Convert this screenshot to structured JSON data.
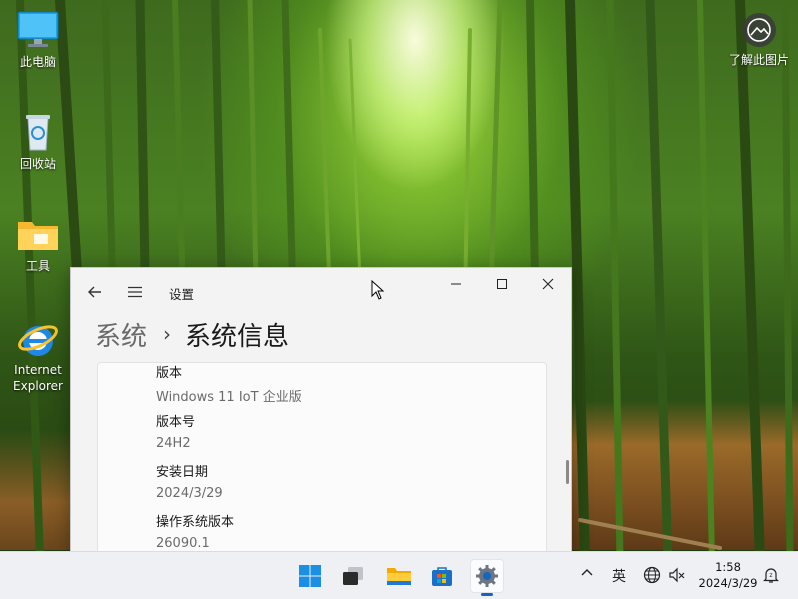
{
  "desktop": {
    "icons": [
      {
        "label": "此电脑"
      },
      {
        "label": "回收站"
      },
      {
        "label": "工具"
      },
      {
        "label": "Internet Explorer"
      }
    ],
    "learn_picture": {
      "label": "了解此图片"
    }
  },
  "window": {
    "title": "设置",
    "breadcrumb": {
      "parent": "系统",
      "separator": "›",
      "current": "系统信息"
    },
    "rows": [
      {
        "label": "版本",
        "value": "Windows 11 IoT 企业版"
      },
      {
        "label": "版本号",
        "value": "24H2"
      },
      {
        "label": "安装日期",
        "value": "2024/3/29"
      },
      {
        "label": "操作系统版本",
        "value": "26090.1"
      }
    ]
  },
  "taskbar": {
    "apps": [
      {
        "name": "start"
      },
      {
        "name": "task-view"
      },
      {
        "name": "file-explorer"
      },
      {
        "name": "microsoft-store"
      },
      {
        "name": "settings",
        "active": true
      }
    ],
    "tray": {
      "ime": "英",
      "time": "1:58",
      "date": "2024/3/29"
    }
  },
  "colors": {
    "accent": "#1665c0",
    "window_bg": "#f3f3f3",
    "taskbar_bg": "#eef0f4"
  }
}
